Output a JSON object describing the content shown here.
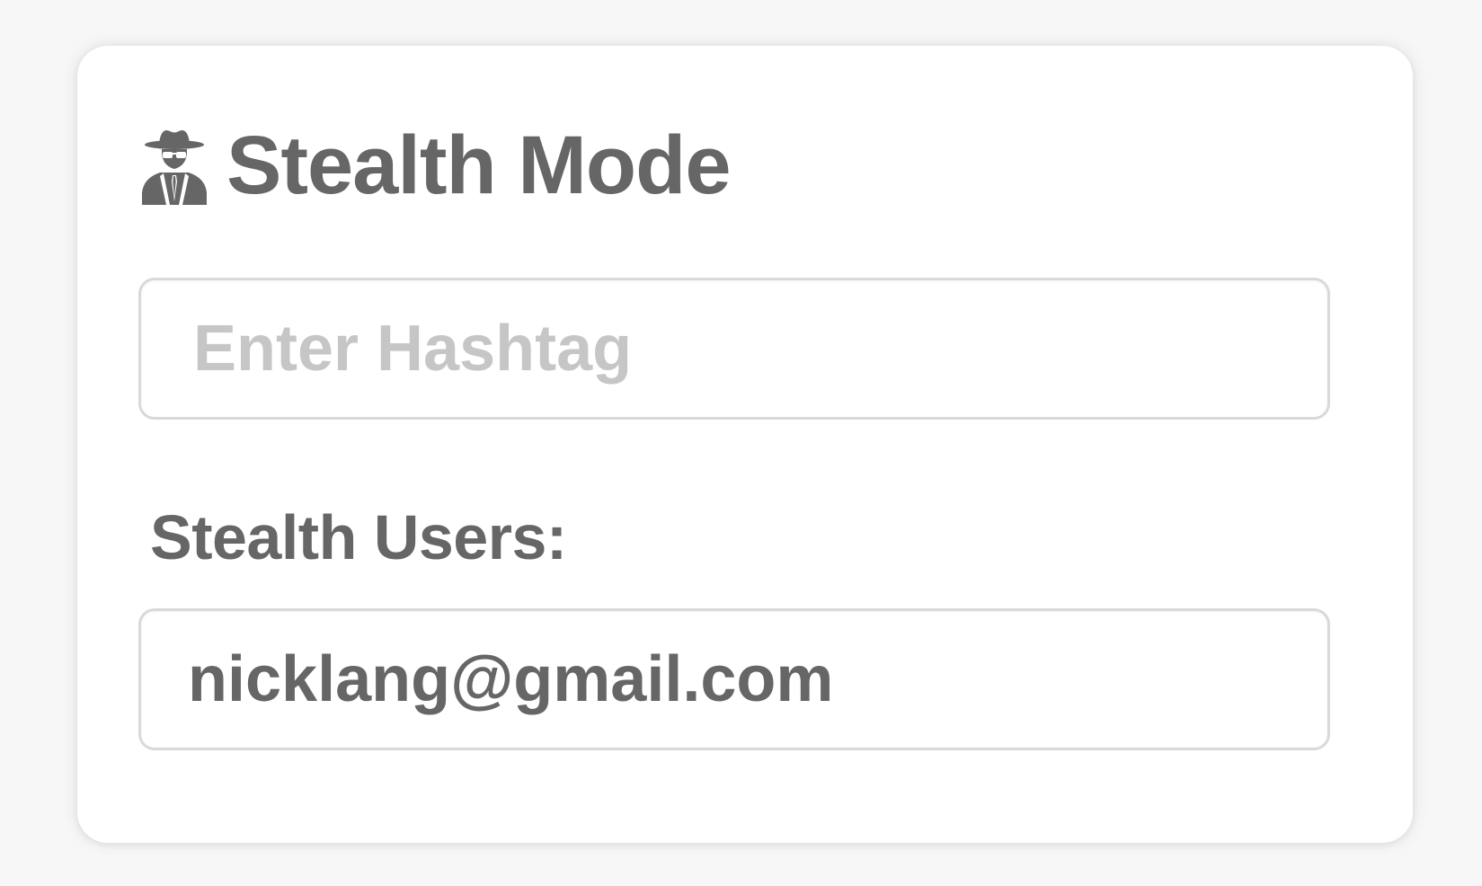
{
  "panel": {
    "title": "Stealth Mode",
    "icon": "spy-icon"
  },
  "hashtag_input": {
    "placeholder": "Enter Hashtag",
    "value": ""
  },
  "stealth_users": {
    "label": "Stealth Users:",
    "value": "nicklang@gmail.com"
  },
  "colors": {
    "background": "#f7f7f7",
    "card": "#ffffff",
    "text": "#666666",
    "placeholder": "#c6c6c6",
    "border": "#d9d9d9"
  }
}
